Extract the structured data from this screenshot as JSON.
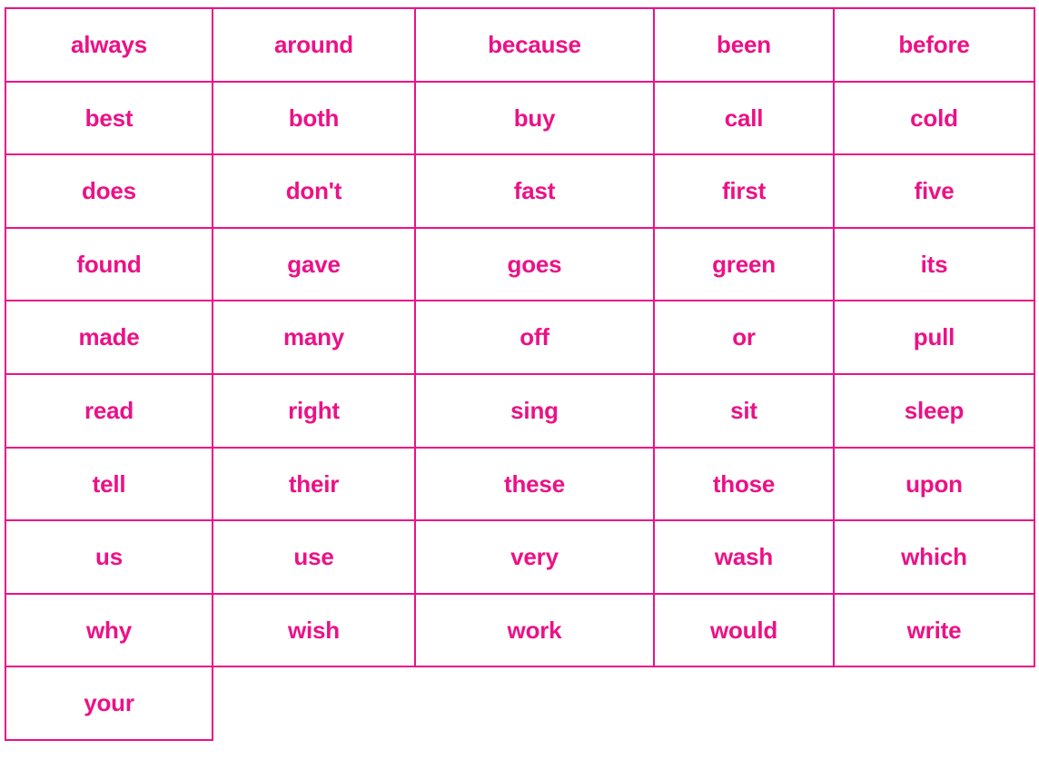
{
  "page": {
    "title": "Sight Word Grid",
    "background_color": "#ffffff",
    "accent_color": "#ec1186",
    "border_color": "#ec1186",
    "text_color": "#ec1186"
  },
  "grid": {
    "columns": 5,
    "rows": 10,
    "total_words": 46,
    "rows_data": [
      [
        "always",
        "around",
        "because",
        "been",
        "before"
      ],
      [
        "best",
        "both",
        "buy",
        "call",
        "cold"
      ],
      [
        "does",
        "don't",
        "fast",
        "first",
        "five"
      ],
      [
        "found",
        "gave",
        "goes",
        "green",
        "its"
      ],
      [
        "made",
        "many",
        "off",
        "or",
        "pull"
      ],
      [
        "read",
        "right",
        "sing",
        "sit",
        "sleep"
      ],
      [
        "tell",
        "their",
        "these",
        "those",
        "upon"
      ],
      [
        "us",
        "use",
        "very",
        "wash",
        "which"
      ],
      [
        "why",
        "wish",
        "work",
        "would",
        "write"
      ],
      [
        "your",
        "",
        "",
        "",
        ""
      ]
    ]
  }
}
